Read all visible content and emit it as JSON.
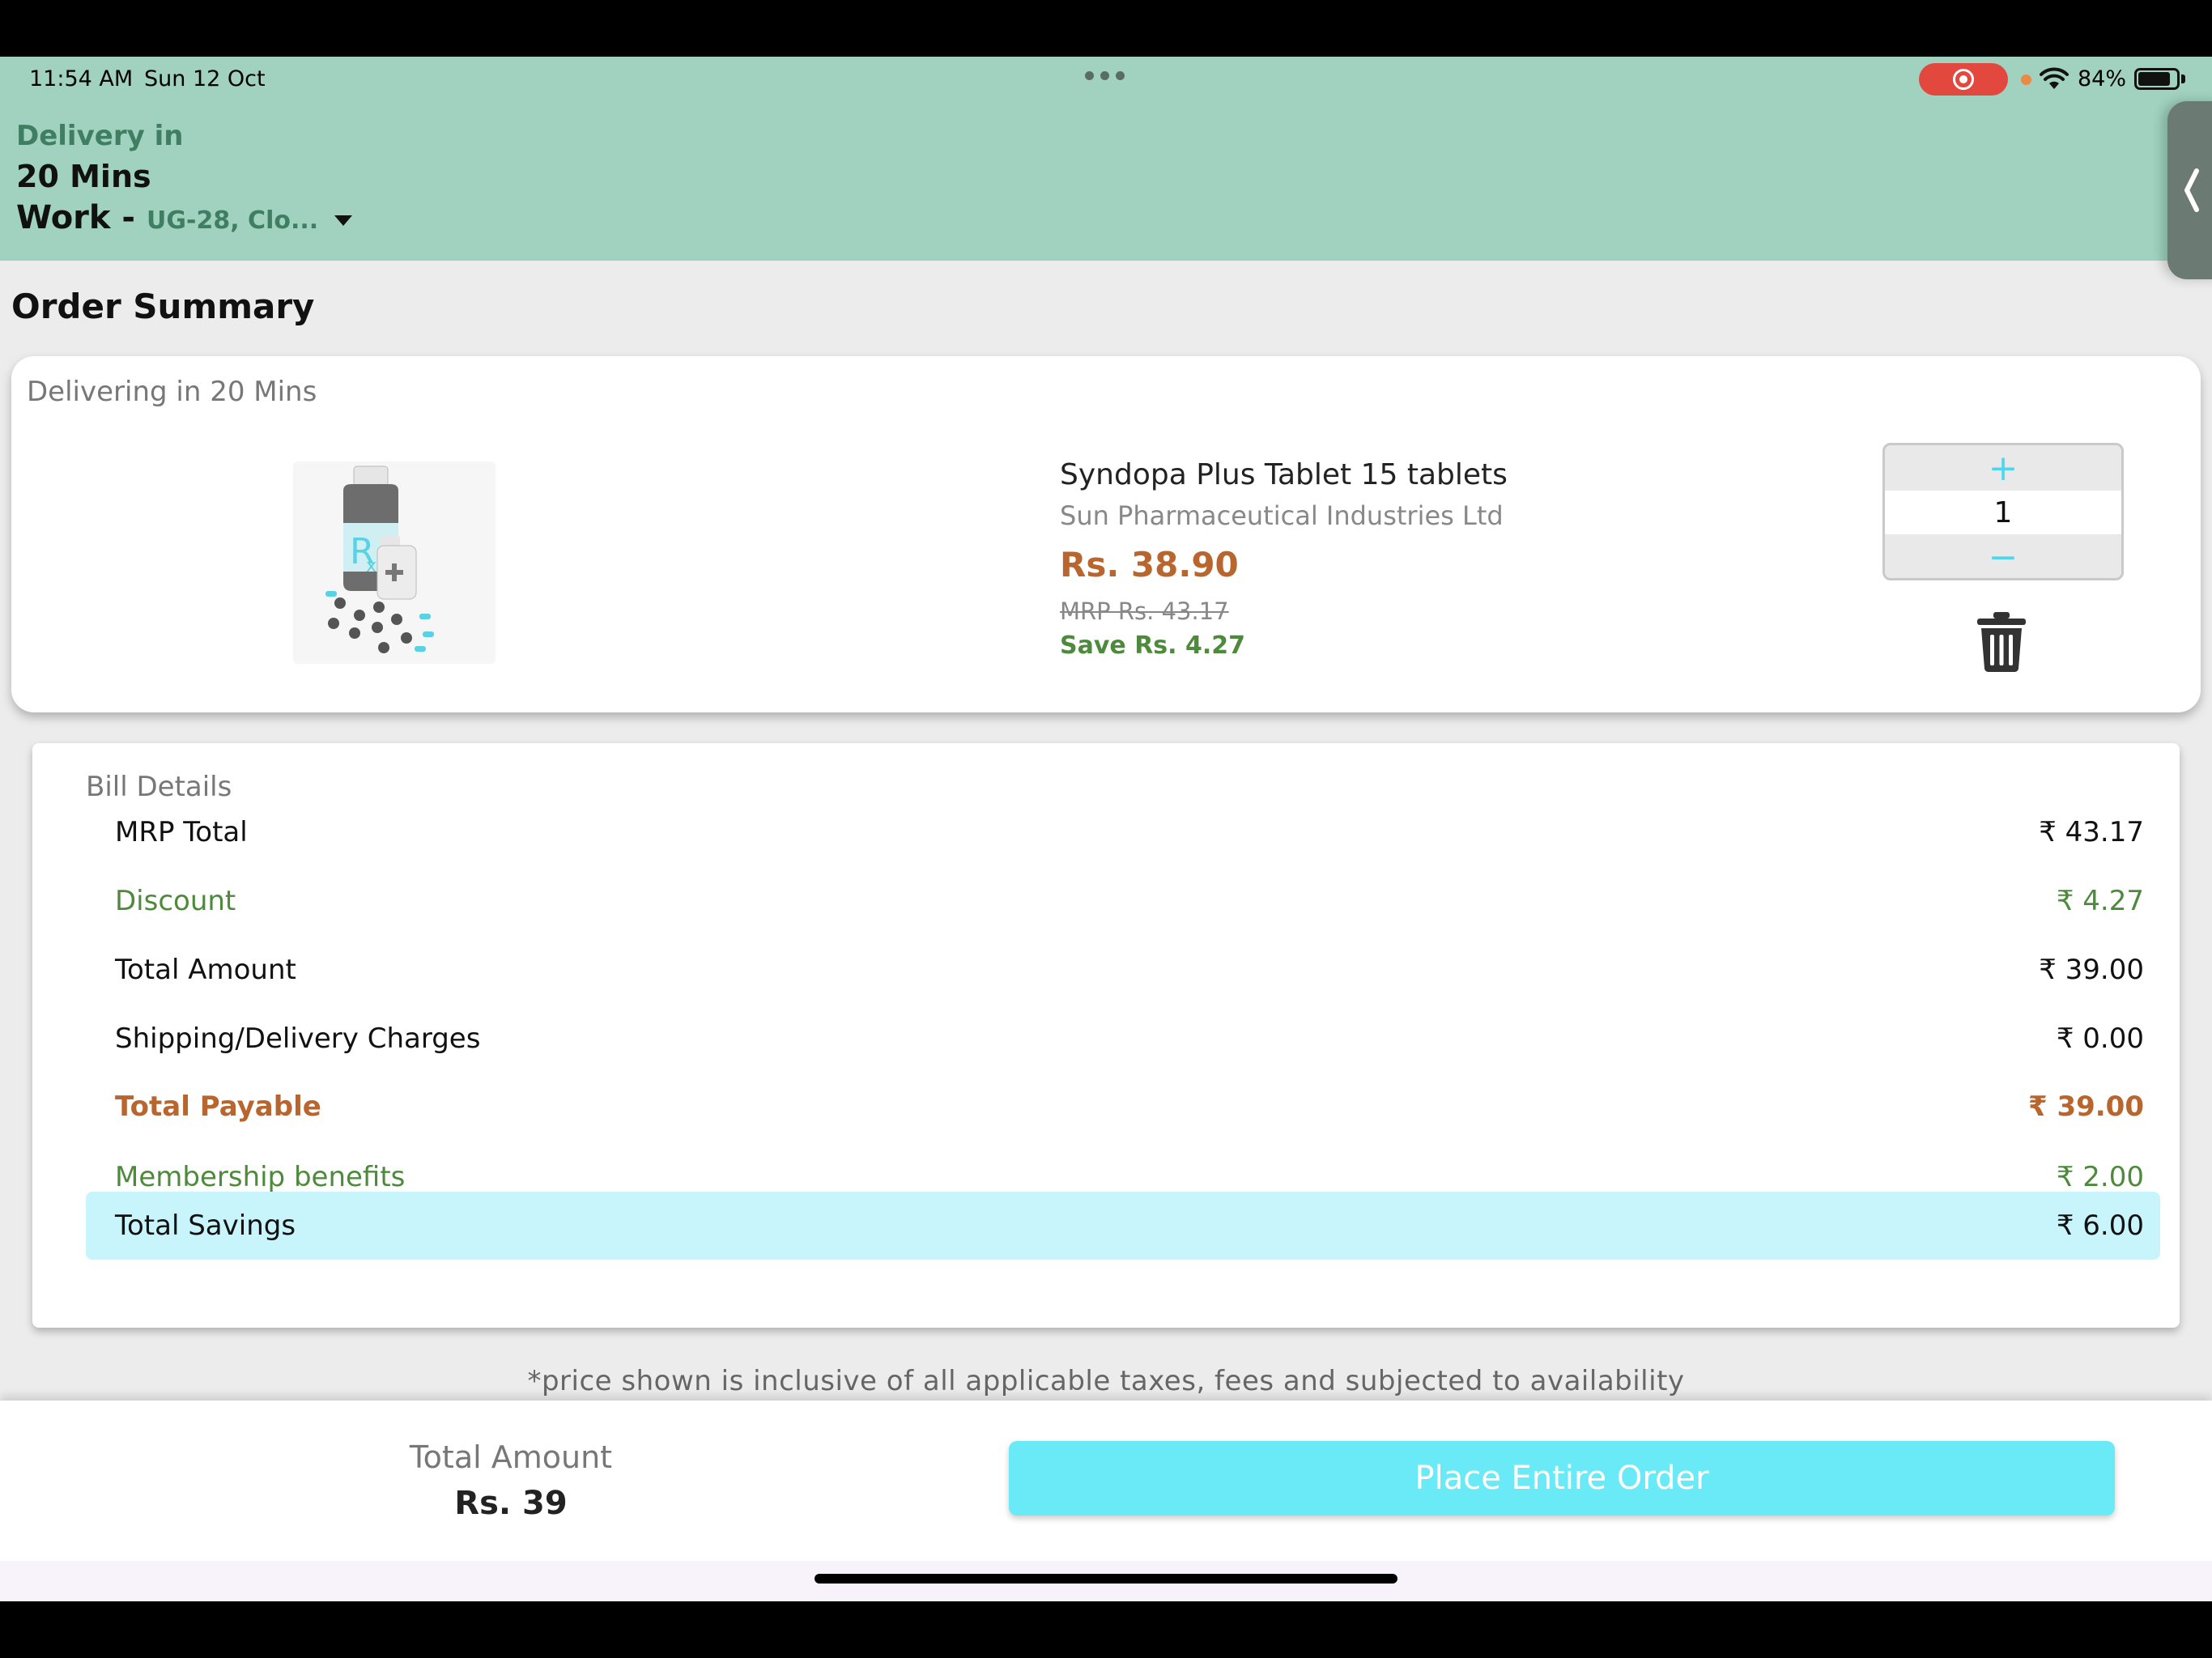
{
  "status_bar": {
    "time": "11:54 AM",
    "date": "Sun 12 Oct",
    "battery": "84%"
  },
  "header": {
    "delivery_label": "Delivery in",
    "delivery_time": "20 Mins",
    "address_type": "Work -",
    "address_text": "UG-28, Clo..."
  },
  "page_title": "Order Summary",
  "item_card": {
    "eta": "Delivering in 20 Mins",
    "name": "Syndopa Plus Tablet 15 tablets",
    "manufacturer": "Sun Pharmaceutical Industries Ltd",
    "price": "Rs. 38.90",
    "mrp": "MRP Rs. 43.17",
    "save": "Save Rs. 4.27",
    "quantity": "1",
    "plus": "+",
    "minus": "−"
  },
  "bill": {
    "title": "Bill Details",
    "rows": [
      {
        "label": "MRP Total",
        "value": "₹ 43.17"
      },
      {
        "label": "Discount",
        "value": "₹ 4.27"
      },
      {
        "label": "Total Amount",
        "value": "₹ 39.00"
      },
      {
        "label": "Shipping/Delivery Charges",
        "value": "₹ 0.00"
      },
      {
        "label": "Total Payable",
        "value": "₹ 39.00"
      },
      {
        "label": "Membership benefits",
        "value": "₹ 2.00"
      },
      {
        "label": "Total Savings",
        "value": "₹ 6.00"
      }
    ]
  },
  "disclaimer": "*price shown is inclusive of all applicable taxes, fees and subjected to availability",
  "bottom_bar": {
    "total_label": "Total Amount",
    "total_value": "Rs. 39",
    "place_order_label": "Place Entire Order"
  },
  "colors": {
    "header_bg": "#a0d2bf",
    "price_orange": "#b8652e",
    "save_green": "#4e8a3c",
    "accent_cyan": "#6ae9f7",
    "savings_bg": "#c8f5fb"
  },
  "icons": [
    "record-icon",
    "wifi-icon",
    "battery-icon",
    "caret-down-icon",
    "chevron-left-icon",
    "medicine-icon",
    "trash-icon"
  ]
}
